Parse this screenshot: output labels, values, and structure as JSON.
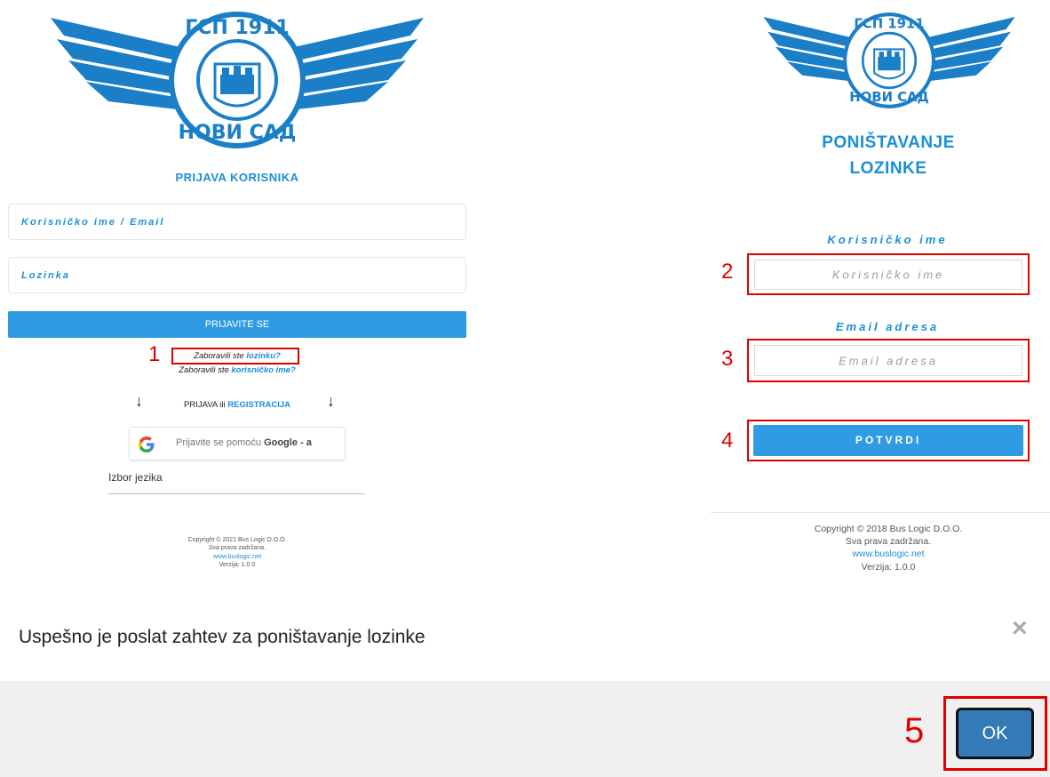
{
  "left_panel": {
    "logo_alt": "ГСП 1911 НОВИ САД",
    "title": "PRIJAVA KORISNIKA",
    "username_placeholder": "Korisničko ime / Email",
    "password_placeholder": "Lozinka",
    "login_button": "PRIJAVITE SE",
    "forgot_password_prefix": "Zaboravili ste",
    "forgot_password_link": "lozinku?",
    "forgot_username_prefix": "Zaboravili ste",
    "forgot_username_link": "korisničko ime?",
    "register_prefix": "PRIJAVA ili",
    "register_link": "REGISTRACIJA",
    "arrow_left": "↓",
    "arrow_right": "↓",
    "google_button_prefix": "Prijavite se pomoću",
    "google_button_bold": "Google - a",
    "language_label": "Izbor jezika",
    "copyright": "Copyright © 2021 Bus Logic D.O.O.",
    "rights": "Sva prava zadržana.",
    "website": "www.buslogic.net",
    "version": "Verzija: 1.0.0"
  },
  "right_panel": {
    "logo_alt": "ГСП 1911 НОВИ САД",
    "title_line1": "PONIŠTAVANJE",
    "title_line2": "LOZINKE",
    "username_label": "Korisničko ime",
    "username_placeholder": "Korisničko ime",
    "email_label": "Email adresa",
    "email_placeholder": "Email adresa",
    "confirm_button": "POTVRDI",
    "copyright": "Copyright © 2018 Bus Logic D.O.O.",
    "rights": "Sva prava zadržana.",
    "website": "www.buslogic.net",
    "version": "Verzija: 1.0.0"
  },
  "steps": {
    "s1": "1",
    "s2": "2",
    "s3": "3",
    "s4": "4",
    "s5": "5"
  },
  "dialog": {
    "message": "Uspešno je poslat zahtev za poništavanje lozinke",
    "close_symbol": "×",
    "ok_button": "OK"
  },
  "colors": {
    "accent": "#1a8fd8",
    "highlight": "#e00000",
    "ok_button": "#337ab7"
  }
}
